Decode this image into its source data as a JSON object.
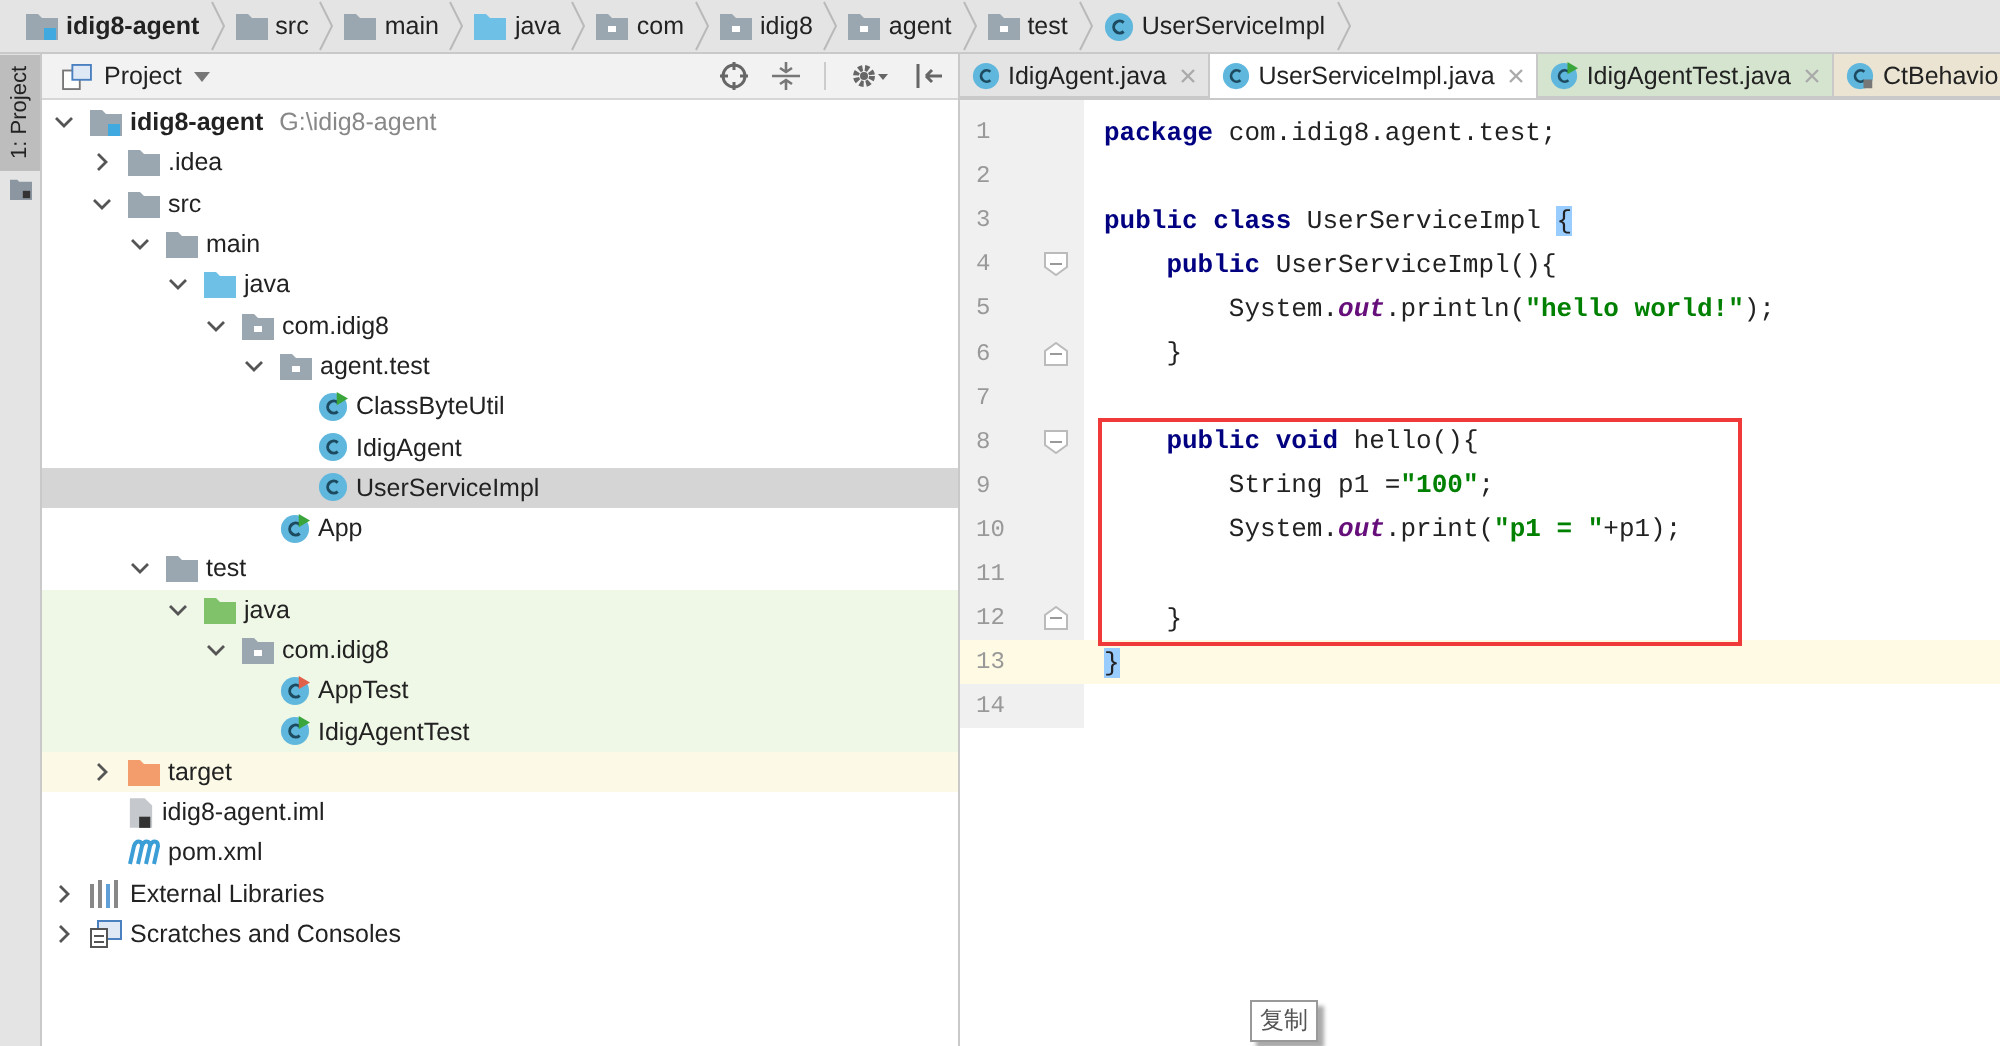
{
  "breadcrumbs": [
    {
      "label": "idig8-agent",
      "kind": "module"
    },
    {
      "label": "src",
      "kind": "folder"
    },
    {
      "label": "main",
      "kind": "folder"
    },
    {
      "label": "java",
      "kind": "source-folder"
    },
    {
      "label": "com",
      "kind": "package"
    },
    {
      "label": "idig8",
      "kind": "package"
    },
    {
      "label": "agent",
      "kind": "package"
    },
    {
      "label": "test",
      "kind": "package"
    },
    {
      "label": "UserServiceImpl",
      "kind": "class"
    }
  ],
  "side_strip": {
    "tab": "1: Project",
    "selected": true
  },
  "project_panel": {
    "title": "Project",
    "tree": [
      {
        "label": "idig8-agent",
        "path": "G:\\idig8-agent",
        "kind": "module",
        "expanded": true,
        "selected": false,
        "children": [
          {
            "label": ".idea",
            "kind": "folder",
            "expanded": false,
            "selected": false
          },
          {
            "label": "src",
            "kind": "folder",
            "expanded": true,
            "selected": false,
            "children": [
              {
                "label": "main",
                "kind": "folder",
                "expanded": true,
                "selected": false,
                "children": [
                  {
                    "label": "java",
                    "kind": "source-folder",
                    "expanded": true,
                    "selected": false,
                    "children": [
                      {
                        "label": "com.idig8",
                        "kind": "package",
                        "expanded": true,
                        "selected": false,
                        "children": [
                          {
                            "label": "agent.test",
                            "kind": "package",
                            "expanded": true,
                            "selected": false,
                            "children": [
                              {
                                "label": "ClassByteUtil",
                                "kind": "runnable-class",
                                "selected": false
                              },
                              {
                                "label": "IdigAgent",
                                "kind": "class",
                                "selected": false
                              },
                              {
                                "label": "UserServiceImpl",
                                "kind": "class",
                                "selected": true
                              }
                            ]
                          },
                          {
                            "label": "App",
                            "kind": "runnable-class",
                            "selected": false
                          }
                        ]
                      }
                    ]
                  }
                ]
              },
              {
                "label": "test",
                "kind": "folder",
                "expanded": true,
                "selected": false,
                "children": [
                  {
                    "label": "java",
                    "kind": "test-folder",
                    "expanded": true,
                    "selected": false,
                    "children": [
                      {
                        "label": "com.idig8",
                        "kind": "package",
                        "expanded": true,
                        "selected": false,
                        "children": [
                          {
                            "label": "AppTest",
                            "kind": "test-class",
                            "selected": false
                          },
                          {
                            "label": "IdigAgentTest",
                            "kind": "runnable-class",
                            "selected": false
                          }
                        ]
                      }
                    ]
                  }
                ]
              }
            ]
          },
          {
            "label": "target",
            "kind": "excluded-folder",
            "expanded": false,
            "selected": false
          },
          {
            "label": "idig8-agent.iml",
            "kind": "iml",
            "selected": false
          },
          {
            "label": "pom.xml",
            "kind": "maven",
            "selected": false
          }
        ]
      },
      {
        "label": "External Libraries",
        "kind": "libraries",
        "expanded": false,
        "selected": false
      },
      {
        "label": "Scratches and Consoles",
        "kind": "scratches",
        "expanded": false,
        "selected": false
      }
    ]
  },
  "editor_tabs": [
    {
      "label": "IdigAgent.java",
      "kind": "class",
      "selected": false
    },
    {
      "label": "UserServiceImpl.java",
      "kind": "class",
      "selected": true
    },
    {
      "label": "IdigAgentTest.java",
      "kind": "test-class",
      "selected": false
    },
    {
      "label": "CtBehavio",
      "kind": "library-class",
      "selected": false
    }
  ],
  "code_lines": [
    {
      "number": "1",
      "tokens": [
        {
          "kind": "keyword",
          "text": "package"
        },
        {
          "kind": "plain",
          "text": " com.idig8.agent.test;"
        }
      ]
    },
    {
      "number": "2"
    },
    {
      "number": "3",
      "tokens": [
        {
          "kind": "keyword",
          "text": "public"
        },
        {
          "kind": "keyword",
          "text": " class"
        },
        {
          "kind": "plain",
          "text": " UserServiceImpl "
        },
        {
          "kind": "brace-match",
          "text": "{"
        }
      ]
    },
    {
      "number": "4",
      "fold_start": true,
      "tokens": [
        {
          "kind": "keyword",
          "text": "    public"
        },
        {
          "kind": "plain",
          "text": " UserServiceImpl(){"
        }
      ]
    },
    {
      "number": "5",
      "tokens": [
        {
          "kind": "plain",
          "text": "        System."
        },
        {
          "kind": "field",
          "text": "out"
        },
        {
          "kind": "plain",
          "text": ".println("
        },
        {
          "kind": "string",
          "text": "\"hello world!\""
        },
        {
          "kind": "plain",
          "text": ");"
        }
      ]
    },
    {
      "number": "6",
      "fold_end": true,
      "tokens": [
        {
          "kind": "plain",
          "text": "    }"
        }
      ]
    },
    {
      "number": "7"
    },
    {
      "number": "8",
      "fold_start": true,
      "boxed": true,
      "tokens": [
        {
          "kind": "keyword",
          "text": "    public"
        },
        {
          "kind": "keyword",
          "text": " void"
        },
        {
          "kind": "plain",
          "text": " hello(){"
        }
      ]
    },
    {
      "number": "9",
      "boxed": true,
      "tokens": [
        {
          "kind": "plain",
          "text": "        String p1 ="
        },
        {
          "kind": "string",
          "text": "\"100\""
        },
        {
          "kind": "plain",
          "text": ";"
        }
      ]
    },
    {
      "number": "10",
      "boxed": true,
      "tokens": [
        {
          "kind": "plain",
          "text": "        System."
        },
        {
          "kind": "field",
          "text": "out"
        },
        {
          "kind": "plain",
          "text": ".print("
        },
        {
          "kind": "string",
          "text": "\"p1 = \""
        },
        {
          "kind": "plain",
          "text": "+p1);"
        }
      ]
    },
    {
      "number": "11",
      "boxed": true
    },
    {
      "number": "12",
      "fold_end": true,
      "boxed": true,
      "tokens": [
        {
          "kind": "plain",
          "text": "    }"
        }
      ]
    },
    {
      "number": "13",
      "current": true,
      "tokens": [
        {
          "kind": "brace-match",
          "text": "}"
        }
      ]
    },
    {
      "number": "14"
    }
  ],
  "tooltip": "复制"
}
